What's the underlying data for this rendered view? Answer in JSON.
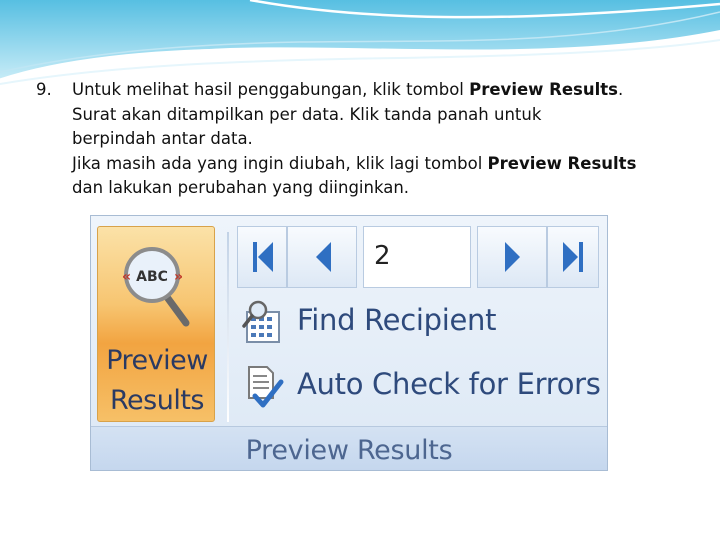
{
  "instructions": {
    "number": "9.",
    "line1_prefix": "Untuk melihat hasil penggabungan, klik tombol ",
    "line1_bold": "Preview Results",
    "line1_suffix": ".",
    "line2": "Surat akan ditampilkan per data. Klik tanda panah untuk",
    "line3": "berpindah antar data.",
    "line4_prefix": "Jika masih ada yang ingin diubah, klik lagi tombol ",
    "line4_bold": "Preview Results",
    "line5": "dan lakukan perubahan yang diinginkan."
  },
  "ribbon": {
    "preview_button": {
      "label_line1": "Preview",
      "label_line2": "Results",
      "icon": "magnifier-abc-icon"
    },
    "navigation": {
      "first_icon": "first-record-icon",
      "previous_icon": "previous-record-icon",
      "record_number": "2",
      "next_icon": "next-record-icon",
      "last_icon": "last-record-icon"
    },
    "find_recipient": {
      "label": "Find Recipient",
      "icon": "find-recipient-icon"
    },
    "auto_check": {
      "label": "Auto Check for Errors",
      "icon": "auto-check-icon"
    },
    "group_label": "Preview Results"
  },
  "colors": {
    "button_orange": "#f2a441",
    "ribbon_blue": "#dce8f5",
    "label_blue": "#2e4a7c",
    "header_cyan": "#7fd0ea"
  }
}
